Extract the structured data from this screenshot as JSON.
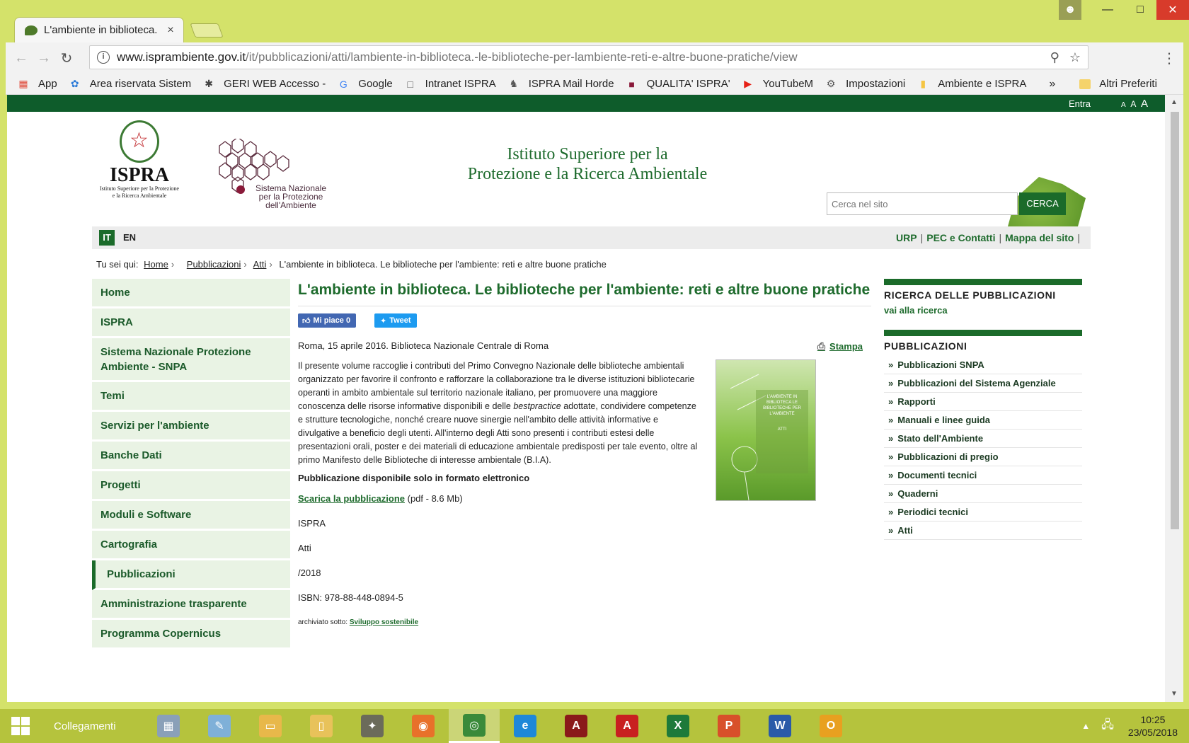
{
  "browser": {
    "tab_title": "L'ambiente in biblioteca.",
    "tab_close": "×",
    "url_host": "www.isprambiente.gov.it",
    "url_path": "/it/pubblicazioni/atti/lambiente-in-biblioteca.-le-biblioteche-per-lambiente-reti-e-altre-buone-pratiche/view",
    "bookmarks": [
      {
        "label": "App",
        "icon": "apps-grid-icon"
      },
      {
        "label": "Area riservata Sistem",
        "icon": "gear-flower-icon"
      },
      {
        "label": "GERI WEB Accesso -",
        "icon": "asterisk-icon"
      },
      {
        "label": "Google",
        "icon": "google-icon"
      },
      {
        "label": "Intranet ISPRA",
        "icon": "page-icon"
      },
      {
        "label": "ISPRA Mail Horde",
        "icon": "horde-icon"
      },
      {
        "label": "QUALITA' ISPRA'",
        "icon": "square-icon"
      },
      {
        "label": "YouTubeM",
        "icon": "youtube-icon"
      },
      {
        "label": "Impostazioni",
        "icon": "settings-icon"
      },
      {
        "label": "Ambiente e ISPRA",
        "icon": "folder-icon"
      }
    ],
    "bookmarks_more": "»",
    "other_bookmarks": "Altri Preferiti"
  },
  "site": {
    "top_login": "Entra",
    "font_sizes": [
      "A",
      "A",
      "A"
    ],
    "ispra_name": "ISPRA",
    "ispra_subtitle_1": "Istituto Superiore per la Protezione",
    "ispra_subtitle_2": "e la Ricerca Ambientale",
    "snpa_line1": "Sistema Nazionale",
    "snpa_line2": "per la Protezione",
    "snpa_line3": "dell'Ambiente",
    "institute_title_1": "Istituto Superiore per la",
    "institute_title_2": "Protezione e la Ricerca Ambientale",
    "search_placeholder": "Cerca nel sito",
    "search_button": "CERCA",
    "lang_it": "IT",
    "lang_en": "EN",
    "top_links": [
      "URP",
      "PEC e Contatti",
      "Mappa del sito"
    ],
    "link_sep": "|"
  },
  "breadcrumb": {
    "prefix": "Tu sei qui:",
    "items": [
      "Home",
      "Pubblicazioni",
      "Atti"
    ],
    "sep": "›",
    "current": "L'ambiente in biblioteca. Le biblioteche per l'ambiente: reti e altre buone pratiche"
  },
  "leftnav": [
    "Home",
    "ISPRA",
    "Sistema Nazionale Protezione Ambiente - SNPA",
    "Temi",
    "Servizi per l'ambiente",
    "Banche Dati",
    "Progetti",
    "Moduli e Software",
    "Cartografia",
    "Pubblicazioni",
    "Amministrazione trasparente",
    "Programma Copernicus"
  ],
  "article": {
    "title": "L'ambiente in biblioteca. Le biblioteche per l'ambiente: reti e altre buone pratiche",
    "fb_label": "Mi piace 0",
    "tweet_label": "Tweet",
    "dateline": "Roma, 15 aprile 2016. Biblioteca Nazionale Centrale di Roma",
    "print_label": "Stampa",
    "body_before": "Il presente volume raccoglie i contributi del Primo Convegno Nazionale delle biblioteche ambientali organizzato per favorire il confronto e rafforzare la collaborazione tra le diverse istituzioni bibliotecarie operanti in ambito ambientale sul territorio nazionale italiano, per promuovere una maggiore conoscenza delle risorse informative disponibili e delle ",
    "body_em": "bestpractice",
    "body_after": " adottate, condividere competenze e strutture tecnologiche, nonché creare nuove sinergie nell'ambito delle attività informative e divulgative a beneficio degli utenti. All'interno degli Atti sono presenti i contributi estesi delle presentazioni orali, poster e dei materiali di educazione ambientale predisposti per tale evento, oltre al primo Manifesto delle Biblioteche di interesse ambientale (B.I.A).",
    "cover_text": "L'AMBIENTE IN BIBLIOTECA LE BIBLIOTECHE PER L'AMBIENTE",
    "cover_atti": "ATTI",
    "availability": "Pubblicazione disponibile solo in formato elettronico",
    "download_label": "Scarica la pubblicazione",
    "download_info": "(pdf - 8.6 Mb)",
    "publisher": "ISPRA",
    "series": "Atti",
    "year": "/2018",
    "isbn": "ISBN: 978-88-448-0894-5",
    "archived_label": "archiviato sotto:",
    "archived_tag": "Sviluppo sostenibile"
  },
  "sidebar": {
    "search_title": "RICERCA DELLE PUBBLICAZIONI",
    "search_link": "vai alla ricerca",
    "pubs_title": "PUBBLICAZIONI",
    "bullet": "»",
    "pubs": [
      "Pubblicazioni SNPA",
      "Pubblicazioni del Sistema Agenziale",
      "Rapporti",
      "Manuali e linee guida",
      "Stato dell'Ambiente",
      "Pubblicazioni di pregio",
      "Documenti tecnici",
      "Quaderni",
      "Periodici tecnici",
      "Atti"
    ]
  },
  "taskbar": {
    "collegamenti": "Collegamenti",
    "time": "10:25",
    "date": "23/05/2018",
    "apps": [
      {
        "name": "calculator",
        "color": "#8aa0b8",
        "glyph": "▦"
      },
      {
        "name": "notepad",
        "color": "#7fb0d8",
        "glyph": "✎"
      },
      {
        "name": "file-explorer",
        "color": "#e8b84a",
        "glyph": "▭"
      },
      {
        "name": "folder",
        "color": "#e8c25a",
        "glyph": "▯"
      },
      {
        "name": "gimp",
        "color": "#6b6b5a",
        "glyph": "✦"
      },
      {
        "name": "firefox",
        "color": "#e8712a",
        "glyph": "◉"
      },
      {
        "name": "chrome",
        "color": "#3a8a3a",
        "glyph": "◎"
      },
      {
        "name": "internet-explorer",
        "color": "#1e88d8",
        "glyph": "e"
      },
      {
        "name": "acrobat",
        "color": "#8a1a1a",
        "glyph": "A"
      },
      {
        "name": "acrobat-reader",
        "color": "#c82020",
        "glyph": "A"
      },
      {
        "name": "excel",
        "color": "#1e7a3a",
        "glyph": "X"
      },
      {
        "name": "powerpoint",
        "color": "#d8502a",
        "glyph": "P"
      },
      {
        "name": "word",
        "color": "#2a5aa8",
        "glyph": "W"
      },
      {
        "name": "outlook",
        "color": "#e8a020",
        "glyph": "O"
      }
    ]
  }
}
